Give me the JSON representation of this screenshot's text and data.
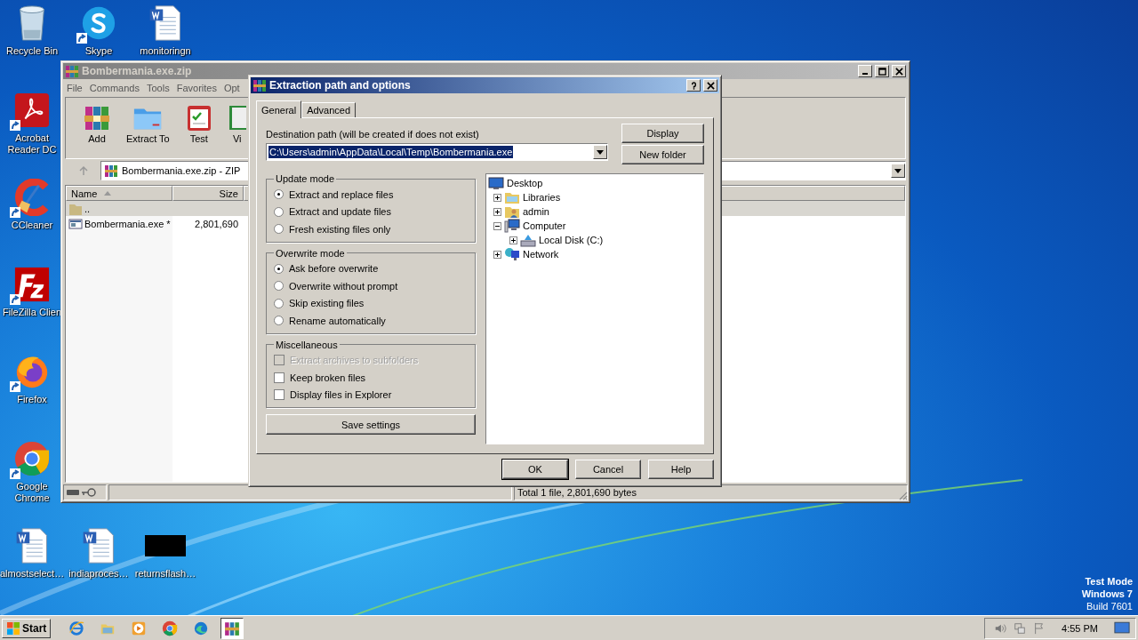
{
  "desktop_icons": [
    {
      "label": "Recycle Bin",
      "kind": "bin",
      "shortcut": false
    },
    {
      "label": "Skype",
      "kind": "chat",
      "shortcut": true
    },
    {
      "label": "monitoringn",
      "kind": "word",
      "shortcut": false
    },
    {
      "label": "Acrobat Reader DC",
      "kind": "acrobat",
      "shortcut": true
    },
    {
      "label": "CCleaner",
      "kind": "ccleaner",
      "shortcut": true
    },
    {
      "label": "FileZilla Clien",
      "kind": "filezilla",
      "shortcut": true
    },
    {
      "label": "Firefox",
      "kind": "firefox",
      "shortcut": true
    },
    {
      "label": "Google Chrome",
      "kind": "chrome",
      "shortcut": true
    },
    {
      "label": "almostselect…",
      "kind": "word",
      "shortcut": false
    },
    {
      "label": "indiaproces…",
      "kind": "word",
      "shortcut": false
    },
    {
      "label": "returnsflash…",
      "kind": "thumb",
      "shortcut": false
    }
  ],
  "archive_window": {
    "title": "Bombermania.exe.zip",
    "active": false,
    "menu": [
      "File",
      "Commands",
      "Tools",
      "Favorites",
      "Opt"
    ],
    "toolbar": [
      {
        "label": "Add",
        "kind": "add"
      },
      {
        "label": "Extract To",
        "kind": "extract"
      },
      {
        "label": "Test",
        "kind": "test"
      },
      {
        "label": "Vi",
        "kind": "view"
      }
    ],
    "address": "Bombermania.exe.zip - ZIP",
    "columns": [
      "Name",
      "Size"
    ],
    "rows": [
      {
        "name": "..",
        "size": "",
        "kind": "up",
        "selected": true
      },
      {
        "name": "Bombermania.exe *",
        "size": "2,801,690",
        "kind": "exe",
        "selected": false
      }
    ],
    "status": "Total 1 file, 2,801,690 bytes"
  },
  "dialog": {
    "title": "Extraction path and options",
    "active": true,
    "tabs": [
      {
        "label": "General",
        "selected": true
      },
      {
        "label": "Advanced",
        "selected": false
      }
    ],
    "path_label": "Destination path (will be created if does not exist)",
    "path": {
      "value": "C:\\Users\\admin\\AppData\\Local\\Temp\\Bombermania.exe",
      "selected": true
    },
    "side_buttons": [
      "Display",
      "New folder"
    ],
    "update_mode": {
      "title": "Update mode",
      "options": [
        {
          "label": "Extract and replace files",
          "selected": true
        },
        {
          "label": "Extract and update files",
          "selected": false
        },
        {
          "label": "Fresh existing files only",
          "selected": false
        }
      ]
    },
    "overwrite_mode": {
      "title": "Overwrite mode",
      "options": [
        {
          "label": "Ask before overwrite",
          "selected": true
        },
        {
          "label": "Overwrite without prompt",
          "selected": false
        },
        {
          "label": "Skip existing files",
          "selected": false
        },
        {
          "label": "Rename automatically",
          "selected": false
        }
      ]
    },
    "miscellaneous": {
      "title": "Miscellaneous",
      "options": [
        {
          "label": "Extract archives to subfolders",
          "checked": false,
          "disabled": true
        },
        {
          "label": "Keep broken files",
          "checked": false,
          "disabled": false
        },
        {
          "label": "Display files in Explorer",
          "checked": false,
          "disabled": false
        }
      ]
    },
    "save_button": "Save settings",
    "tree": {
      "label": "Desktop",
      "kind": "desktop",
      "children": [
        {
          "label": "Libraries",
          "kind": "library",
          "expanded": false
        },
        {
          "label": "admin",
          "kind": "user",
          "expanded": false
        },
        {
          "label": "Computer",
          "kind": "computer",
          "expanded": true,
          "children": [
            {
              "label": "Local Disk (C:)",
              "kind": "disk",
              "expanded": false
            }
          ]
        },
        {
          "label": "Network",
          "kind": "network",
          "expanded": false
        }
      ]
    },
    "buttons": [
      "OK",
      "Cancel",
      "Help"
    ]
  },
  "taskbar": {
    "start": "Start",
    "items": [
      {
        "kind": "ie",
        "active": false
      },
      {
        "kind": "folder",
        "active": false
      },
      {
        "kind": "media",
        "active": false
      },
      {
        "kind": "chrome",
        "active": false
      },
      {
        "kind": "edge",
        "active": false
      },
      {
        "kind": "winrar",
        "active": true
      }
    ],
    "clock": "4:55 PM"
  },
  "os_notice": [
    "Test Mode",
    "Windows 7",
    "Build 7601"
  ]
}
